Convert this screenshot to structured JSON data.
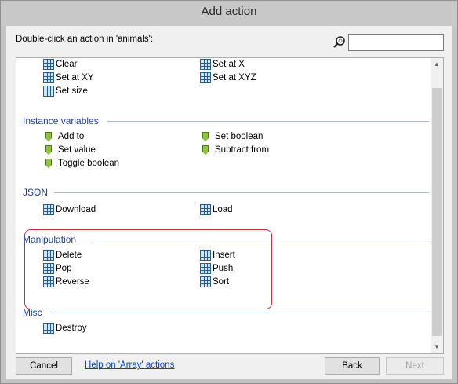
{
  "window": {
    "title": "Add action"
  },
  "prompt": "Double-click an action in 'animals':",
  "search": {
    "value": "",
    "placeholder": ""
  },
  "groups": [
    {
      "name": "",
      "items": [
        "Clear",
        "Set at X",
        "Set at XY",
        "Set at XYZ",
        "Set size"
      ],
      "icon": "grid-icon"
    },
    {
      "name": "Instance variables",
      "items": [
        "Add to",
        "Set boolean",
        "Set value",
        "Subtract from",
        "Toggle boolean"
      ],
      "icon": "instance-variable-icon"
    },
    {
      "name": "JSON",
      "items": [
        "Download",
        "Load"
      ],
      "icon": "grid-icon"
    },
    {
      "name": "Manipulation",
      "items": [
        "Delete",
        "Insert",
        "Pop",
        "Push",
        "Reverse",
        "Sort"
      ],
      "icon": "grid-icon"
    },
    {
      "name": "Misc",
      "items": [
        "Destroy"
      ],
      "icon": "grid-icon"
    }
  ],
  "buttons": {
    "cancel": "Cancel",
    "help": "Help on 'Array' actions",
    "back": "Back",
    "next": "Next"
  },
  "colors": {
    "group_header": "#1f3f99",
    "highlight": "#d02a3a",
    "link": "#0645c8"
  }
}
